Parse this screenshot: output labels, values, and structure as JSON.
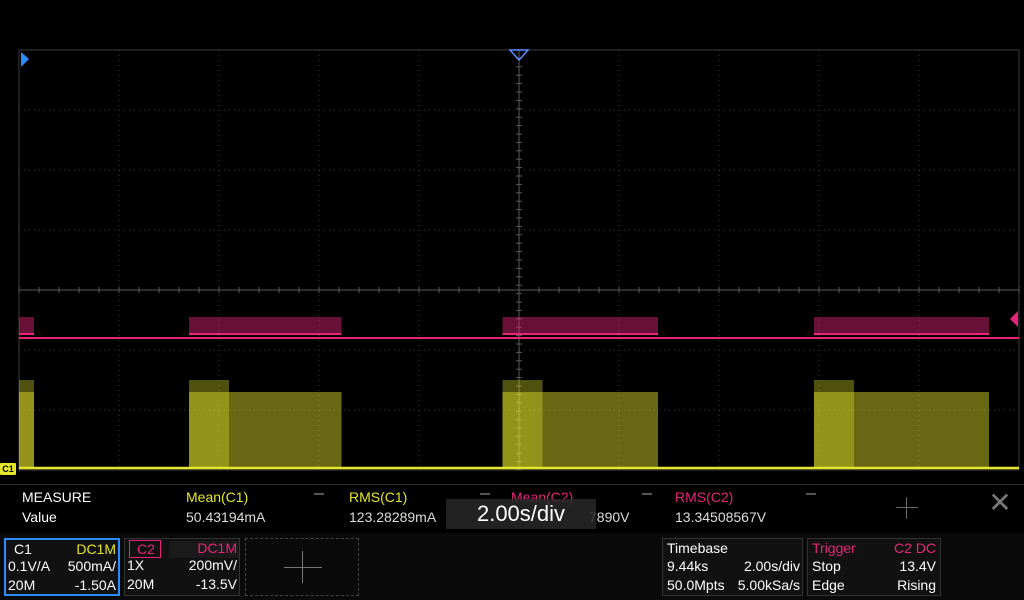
{
  "colors": {
    "ch1": "#e6e62c",
    "ch2": "#e8247a",
    "grid": "#3c3c3c",
    "bg": "#000000",
    "accent_blue": "#2a8cff"
  },
  "icons": {
    "ch1_offset_marker": "C1",
    "ch2_offset_marker": "C2",
    "trigger_position_marker": "triangle-down",
    "ch1_level_marker": "triangle-right",
    "ch2_level_marker": "triangle-left"
  },
  "timebase_overlay": "2.00s/div",
  "measure": {
    "title": "MEASURE",
    "row_label": "Value",
    "items": [
      {
        "name": "Mean(C1)",
        "value": "50.43194mA"
      },
      {
        "name": "RMS(C1)",
        "value": "123.28289mA"
      },
      {
        "name": "Mean(C2)",
        "value": "7890V"
      },
      {
        "name": "RMS(C2)",
        "value": "13.34508567V"
      }
    ]
  },
  "channel1": {
    "name": "C1",
    "coupling": "DC1M",
    "probe": "0.1V/A",
    "scale": "500mA/",
    "bandwidth": "20M",
    "offset": "-1.50A"
  },
  "channel2": {
    "name": "C2",
    "coupling": "DC1M",
    "probe": "1X",
    "scale": "200mV/",
    "bandwidth": "20M",
    "offset": "-13.5V"
  },
  "timebase": {
    "title": "Timebase",
    "delay": "9.44ks",
    "scale": "2.00s/div",
    "memory": "50.0Mpts",
    "sample_rate": "5.00kSa/s"
  },
  "trigger": {
    "title": "Trigger",
    "source": "C2",
    "coupling": "DC",
    "state": "Stop",
    "level": "13.4V",
    "type": "Edge",
    "slope": "Rising"
  },
  "waveform_bursts": [
    {
      "start": 0.0,
      "end": 0.3
    },
    {
      "start": 3.4,
      "end": 6.45
    },
    {
      "start": 9.67,
      "end": 12.78
    },
    {
      "start": 15.9,
      "end": 19.4
    }
  ]
}
